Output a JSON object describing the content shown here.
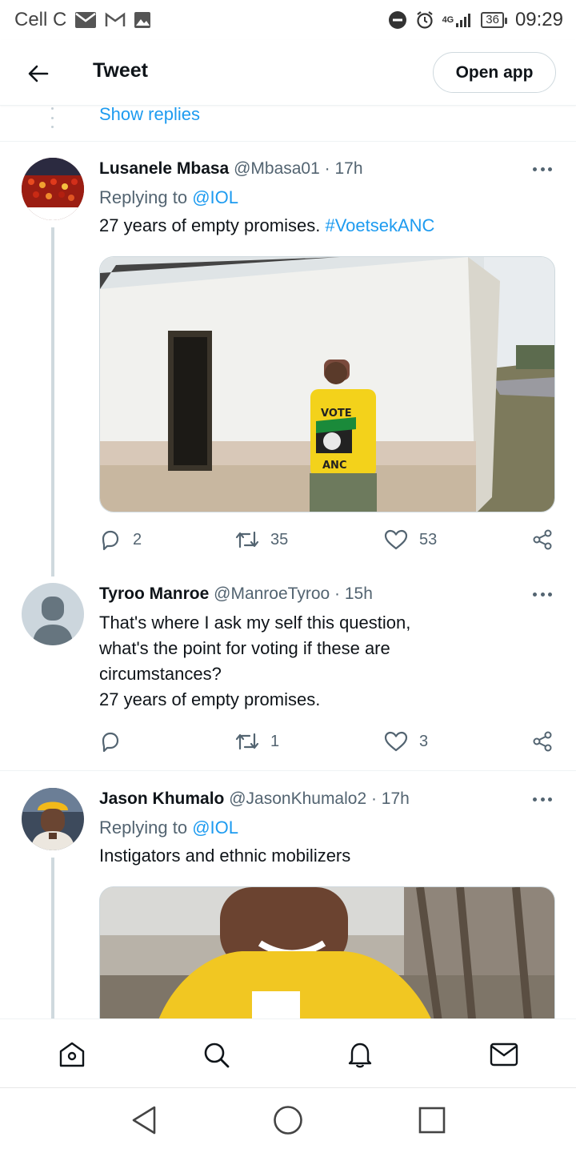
{
  "status_bar": {
    "carrier": "Cell C",
    "network": "4G",
    "battery": "36",
    "time": "09:29"
  },
  "header": {
    "title": "Tweet",
    "open_app_label": "Open app"
  },
  "thread": {
    "show_replies_label": "Show replies"
  },
  "tweets": [
    {
      "name": "Lusanele Mbasa",
      "handle": "@Mbasa01",
      "time": "· 17h",
      "replying_prefix": "Replying to",
      "replying_to": "@IOL",
      "text": "27 years of empty promises.",
      "hashtag": "#VoetsekANC",
      "photo_text": [
        "VOTE",
        "ANC"
      ],
      "replies": "2",
      "retweets": "35",
      "likes": "53"
    },
    {
      "name": "Tyroo Manroe",
      "handle": "@ManroeTyroo",
      "time": "· 15h",
      "text_lines": [
        "That's where I ask my self this question,",
        "what's the point for voting if these are",
        "circumstances?",
        "27 years of empty promises."
      ],
      "replies": "",
      "retweets": "1",
      "likes": "3"
    },
    {
      "name": "Jason Khumalo",
      "handle": "@JasonKhumalo2",
      "time": "· 17h",
      "replying_prefix": "Replying to",
      "replying_to": "@IOL",
      "text": "Instigators and ethnic mobilizers"
    }
  ],
  "icons": {
    "back": "arrow-left-icon",
    "more": "more-icon",
    "reply": "reply-icon",
    "retweet": "retweet-icon",
    "like": "heart-icon",
    "share": "share-icon",
    "home": "home-icon",
    "search": "search-icon",
    "notifications": "bell-icon",
    "messages": "mail-icon"
  },
  "colors": {
    "accent": "#1d9bf0",
    "text_primary": "#0f1419",
    "text_secondary": "#536471"
  }
}
